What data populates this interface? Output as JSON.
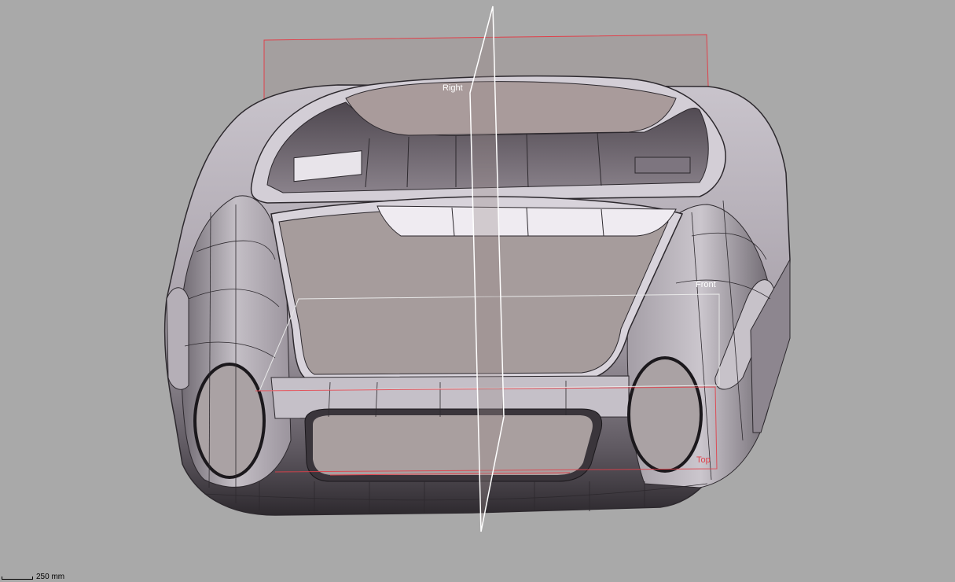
{
  "viewport": {
    "background_color": "#a9a9a9",
    "construction_planes": [
      {
        "name": "Right",
        "color": "#ffffff"
      },
      {
        "name": "Front",
        "color": "#ffffff"
      },
      {
        "name": "Top",
        "color": "#e0404a"
      }
    ],
    "model_color": "#b8b0b8",
    "scale_bar": {
      "label": "250 mm"
    }
  }
}
